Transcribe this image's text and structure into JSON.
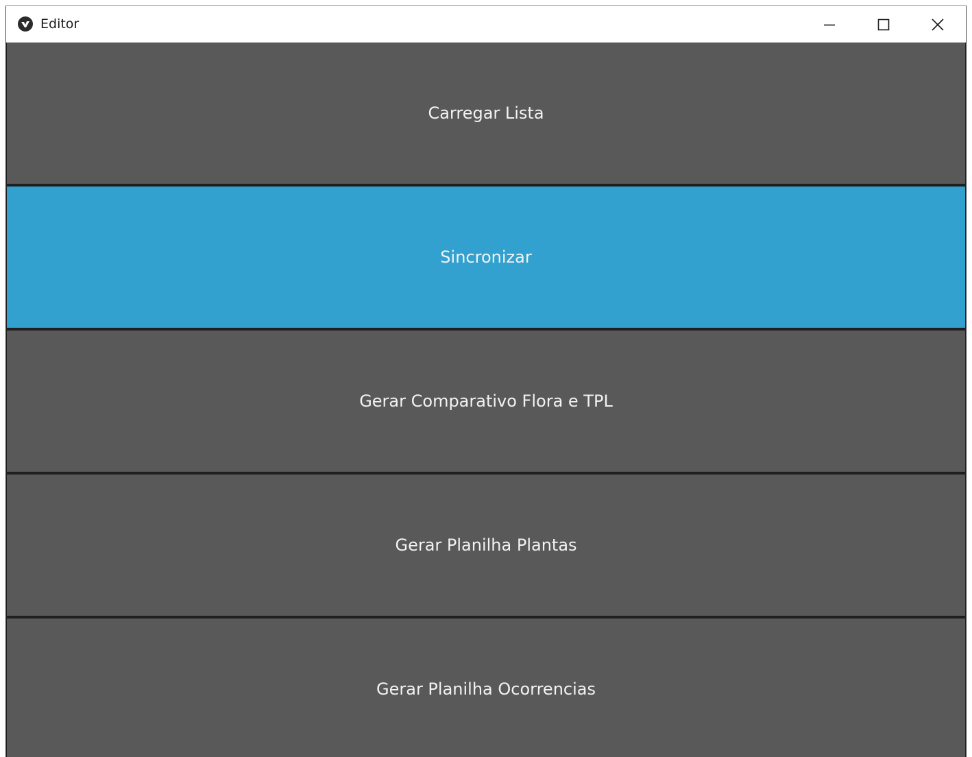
{
  "window": {
    "title": "Editor",
    "controls": {
      "minimize": "minimize-icon",
      "maximize": "maximize-icon",
      "close": "close-icon"
    }
  },
  "colors": {
    "button_bg": "#595959",
    "button_active_bg": "#33a1cf",
    "button_text": "#f2f2f2",
    "separator": "#1f1f1f"
  },
  "buttons": [
    {
      "label": "Carregar Lista"
    },
    {
      "label": "Sincronizar"
    },
    {
      "label": "Gerar Comparativo Flora e TPL"
    },
    {
      "label": "Gerar Planilha Plantas"
    },
    {
      "label": "Gerar Planilha Ocorrencias"
    }
  ]
}
